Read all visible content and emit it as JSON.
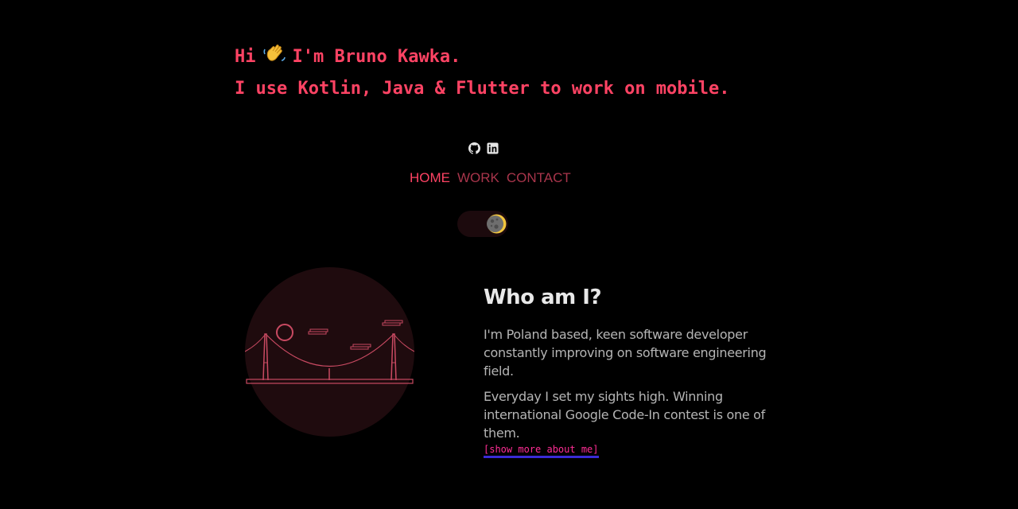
{
  "hero": {
    "greeting_hi": "Hi",
    "wave_emoji": "waving-hand-icon",
    "greeting_name": "I'm Bruno Kawka.",
    "tagline": "I use Kotlin, Java & Flutter to work on mobile.",
    "color": "#ff4364"
  },
  "socials": [
    {
      "icon": "github-icon"
    },
    {
      "icon": "linkedin-icon"
    }
  ],
  "nav": {
    "home": "HOME",
    "work": "WORK",
    "contact": "CONTACT",
    "active": "HOME"
  },
  "theme_toggle": {
    "icon": "moon-icon",
    "mode": "dark"
  },
  "about": {
    "title": "Who am I?",
    "paragraph1": "I'm Poland based, keen software developer constantly improving on software engineering field.",
    "paragraph2": "Everyday I set my sights high. Winning international Google Code-In contest is one of them.",
    "more_link": "[show more about me]"
  },
  "colors": {
    "background": "#000000",
    "accent": "#ff4364",
    "nav_inactive": "#a8354b",
    "link": "#ff2d95",
    "link_underline": "#3a2bd6"
  }
}
